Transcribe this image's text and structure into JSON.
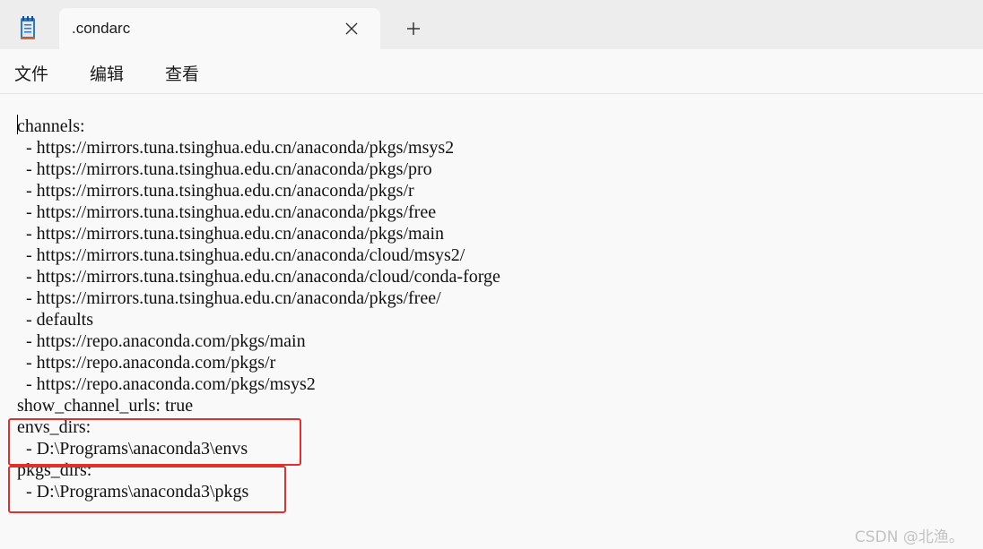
{
  "window": {
    "app_icon": "notepad-icon",
    "tab_title": ".condarc",
    "close_icon": "close-icon",
    "new_tab_icon": "plus-icon"
  },
  "menu": {
    "file": "文件",
    "edit": "编辑",
    "view": "查看"
  },
  "editor": {
    "lines": [
      "channels:",
      "  - https://mirrors.tuna.tsinghua.edu.cn/anaconda/pkgs/msys2",
      "  - https://mirrors.tuna.tsinghua.edu.cn/anaconda/pkgs/pro",
      "  - https://mirrors.tuna.tsinghua.edu.cn/anaconda/pkgs/r",
      "  - https://mirrors.tuna.tsinghua.edu.cn/anaconda/pkgs/free",
      "  - https://mirrors.tuna.tsinghua.edu.cn/anaconda/pkgs/main",
      "  - https://mirrors.tuna.tsinghua.edu.cn/anaconda/cloud/msys2/",
      "  - https://mirrors.tuna.tsinghua.edu.cn/anaconda/cloud/conda-forge",
      "  - https://mirrors.tuna.tsinghua.edu.cn/anaconda/pkgs/free/",
      "  - defaults",
      "  - https://repo.anaconda.com/pkgs/main",
      "  - https://repo.anaconda.com/pkgs/r",
      "  - https://repo.anaconda.com/pkgs/msys2",
      "show_channel_urls: true",
      "envs_dirs:",
      "  - D:\\Programs\\anaconda3\\envs",
      "pkgs_dirs:",
      "  - D:\\Programs\\anaconda3\\pkgs"
    ]
  },
  "annotation_color": "#e0302e",
  "watermark": "CSDN @北渔。"
}
